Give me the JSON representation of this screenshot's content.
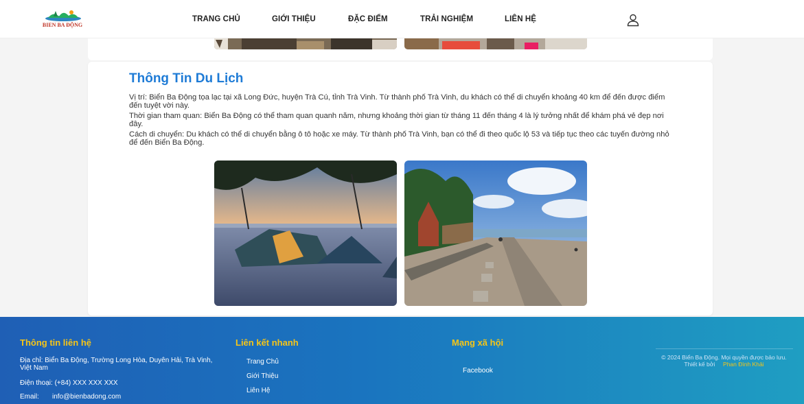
{
  "header": {
    "logo_text": "BIEN BA ĐỘNG",
    "nav": [
      {
        "label": "TRANG CHỦ"
      },
      {
        "label": "GIỚI THIỆU"
      },
      {
        "label": "ĐẶC ĐIỂM"
      },
      {
        "label": "TRẢI NGHIỆM"
      },
      {
        "label": "LIÊN HỆ"
      }
    ],
    "user_icon": "user-icon"
  },
  "travel_info": {
    "title": "Thông Tin Du Lịch",
    "paragraphs": [
      "Vị trí: Biển Ba Động tọa lạc tại xã Long Đức, huyện Trà Cú, tỉnh Trà Vinh. Từ thành phố Trà Vinh, du khách có thể di chuyển khoảng 40 km để đến được điểm đến tuyệt vời này.",
      "Thời gian tham quan: Biển Ba Động có thể tham quan quanh năm, nhưng khoảng thời gian từ tháng 11 đến tháng 4 là lý tưởng nhất để khám phá vẻ đẹp nơi đây.",
      "Cách di chuyển: Du khách có thể di chuyển bằng ô tô hoặc xe máy. Từ thành phố Trà Vinh, bạn có thể đi theo quốc lộ 53 và tiếp tục theo các tuyến đường nhỏ để đến Biển Ba Động."
    ]
  },
  "footer": {
    "contact": {
      "heading": "Thông tin liên hệ",
      "address": "Địa chỉ: Biển Ba Động, Trường Long Hòa, Duyên Hải, Trà Vinh, Việt Nam",
      "phone": "Điện thoại: (+84) XXX XXX XXX",
      "email_label": "Email:",
      "email": "info@bienbadong.com"
    },
    "quick_links": {
      "heading": "Liên kết nhanh",
      "links": [
        "Trang Chủ",
        "Giới Thiệu",
        "Liên Hệ"
      ]
    },
    "social": {
      "heading": "Mạng xã hội",
      "links": [
        "Facebook"
      ]
    },
    "copyright": "© 2024 Biển Ba Động. Mọi quyền được bảo lưu.",
    "designed_by_label": "Thiết kế bởi",
    "designer": "Phan Đình Khải"
  },
  "colors": {
    "title_blue": "#1e7bd6",
    "footer_heading": "#f5c518",
    "footer_start": "#1f5fb5",
    "footer_end": "#1f9ec2"
  }
}
